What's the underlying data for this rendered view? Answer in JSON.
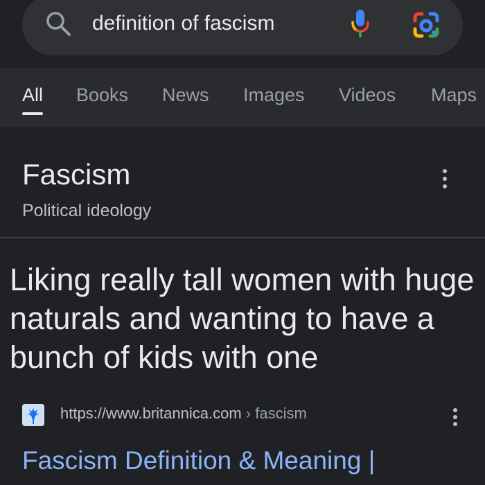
{
  "search": {
    "query": "definition of fascism",
    "search_icon": "search-icon",
    "mic_icon": "microphone-icon",
    "lens_icon": "google-lens-icon"
  },
  "tabs": [
    {
      "label": "All",
      "active": true
    },
    {
      "label": "Books",
      "active": false
    },
    {
      "label": "News",
      "active": false
    },
    {
      "label": "Images",
      "active": false
    },
    {
      "label": "Videos",
      "active": false
    },
    {
      "label": "Maps",
      "active": false
    }
  ],
  "knowledge_panel": {
    "title": "Fascism",
    "subtitle": "Political ideology",
    "definition": "Liking really tall women with huge naturals and wanting to have a bunch of kids with one"
  },
  "result": {
    "url": "https://www.britannica.com",
    "breadcrumb": " › fascism",
    "title": "Fascism Definition & Meaning |"
  },
  "colors": {
    "background": "#202124",
    "tab_bar": "#2a2b2e",
    "link": "#8ab4f8",
    "text": "#e8eaed",
    "muted": "#9aa0a6"
  }
}
